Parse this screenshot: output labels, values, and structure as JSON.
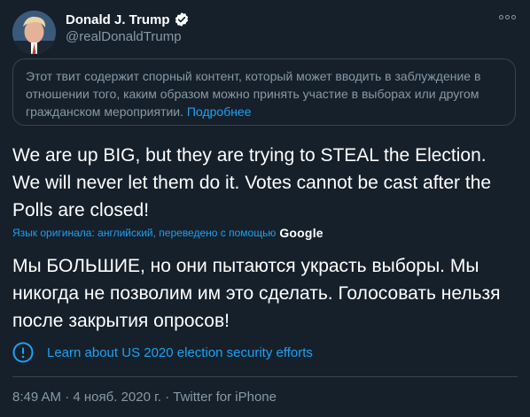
{
  "author": {
    "display_name": "Donald J. Trump",
    "handle": "@realDonaldTrump",
    "verified": true,
    "avatar_icon": "profile-photo"
  },
  "notice": {
    "text": "Этот твит содержит спорный контент, который может вводить в заблуждение в отношении того, каким образом можно принять участие в выборах или другом гражданском мероприятии.",
    "link_label": "Подробнее"
  },
  "tweet": {
    "text": "We are up BIG, but they are trying to STEAL the Election. We will never let them do it. Votes cannot be cast after the Polls are closed!"
  },
  "translation": {
    "label": "Язык оригинала: английский, переведено с помощью",
    "provider": "Google",
    "text": "Мы БОЛЬШИЕ, но они пытаются украсть выборы. Мы никогда не позволим им это сделать. Голосовать нельзя после закрытия опросов!"
  },
  "election_link": {
    "label": "Learn about US 2020 election security efforts",
    "icon": "info-icon"
  },
  "meta": {
    "time": "8:49 AM",
    "separator": " · ",
    "date": "4 нояб. 2020 г.",
    "source": "Twitter for iPhone"
  },
  "colors": {
    "background": "#15202b",
    "accent": "#1da1f2",
    "muted": "#8899a6",
    "border": "#38444d"
  }
}
